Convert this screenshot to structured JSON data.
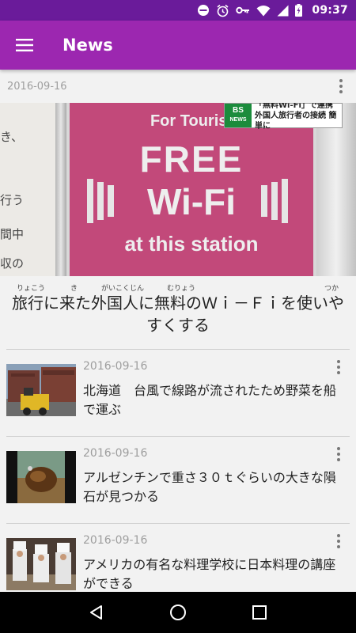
{
  "status_bar": {
    "time": "09:37"
  },
  "app_bar": {
    "title": "News"
  },
  "hero": {
    "date": "2016-09-16",
    "image": {
      "poster_line1": "For Tourist",
      "poster_line2": "FREE",
      "poster_line3": "Wi-Fi",
      "poster_line4": "at this station",
      "side_text": [
        "き、",
        "行う",
        "間中",
        "収の"
      ],
      "caption_logo_top": "BS",
      "caption_logo_bottom": "NEWS",
      "caption_line1": "「無料Wi-Fi」で連携",
      "caption_line2": "外国人旅行者の接続 簡単に"
    },
    "furigana": [
      "りょこう",
      "き",
      "がいこくじん",
      "むりょう",
      "つか"
    ],
    "title": "旅行に来た外国人に無料のＷｉ－Ｆｉを使いやすくする"
  },
  "news_items": [
    {
      "date": "2016-09-16",
      "title": "北海道　台風で線路が流されたため野菜を船で運ぶ",
      "thumb": "containers"
    },
    {
      "date": "2016-09-16",
      "title": "アルゼンチンで重さ３０ｔぐらいの大きな隕石が見つかる",
      "thumb": "meteorite"
    },
    {
      "date": "2016-09-16",
      "title": "アメリカの有名な料理学校に日本料理の講座ができる",
      "thumb": "chefs"
    }
  ],
  "icons": {
    "menu": "hamburger-menu-icon",
    "more": "overflow-menu-icon",
    "nav": [
      "back-icon",
      "home-icon",
      "recents-icon"
    ],
    "status": [
      "do-not-disturb-icon",
      "alarm-icon",
      "vpn-key-icon",
      "wifi-icon",
      "signal-icon",
      "battery-charging-icon"
    ]
  },
  "colors": {
    "status_bar": "#6a1b9a",
    "app_bar": "#9c27b0",
    "background": "#f2f2f2"
  }
}
